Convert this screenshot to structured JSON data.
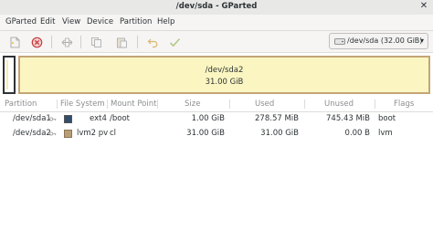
{
  "window": {
    "title": "/dev/sda - GParted"
  },
  "menu": [
    "GParted",
    "Edit",
    "View",
    "Device",
    "Partition",
    "Help"
  ],
  "toolbar": {
    "buttons": [
      "new-icon",
      "delete-icon",
      "resize-move-icon",
      "copy-icon",
      "paste-icon",
      "undo-icon",
      "apply-icon"
    ]
  },
  "device_selector": {
    "label": "/dev/sda (32.00 GiB)"
  },
  "disk_map": {
    "partition_name": "/dev/sda2",
    "partition_size": "31.00 GiB"
  },
  "table": {
    "headers": [
      "Partition",
      "File System",
      "Mount Point",
      "Size",
      "Used",
      "Unused",
      "Flags"
    ],
    "rows": [
      {
        "partition": "/dev/sda1",
        "fs": "ext4",
        "fs_color": "#314e6c",
        "mount": "/boot",
        "size": "1.00 GiB",
        "used": "278.57 MiB",
        "unused": "745.43 MiB",
        "flags": "boot"
      },
      {
        "partition": "/dev/sda2",
        "fs": "lvm2 pv",
        "fs_color": "#b89e76",
        "mount": "cl",
        "size": "31.00 GiB",
        "used": "31.00 GiB",
        "unused": "0.00 B",
        "flags": "lvm"
      }
    ]
  },
  "colors": {
    "lvm_border": "#c4a477",
    "lvm_fill": "#fbf6c1",
    "ext4_swatch": "#314e6c"
  }
}
